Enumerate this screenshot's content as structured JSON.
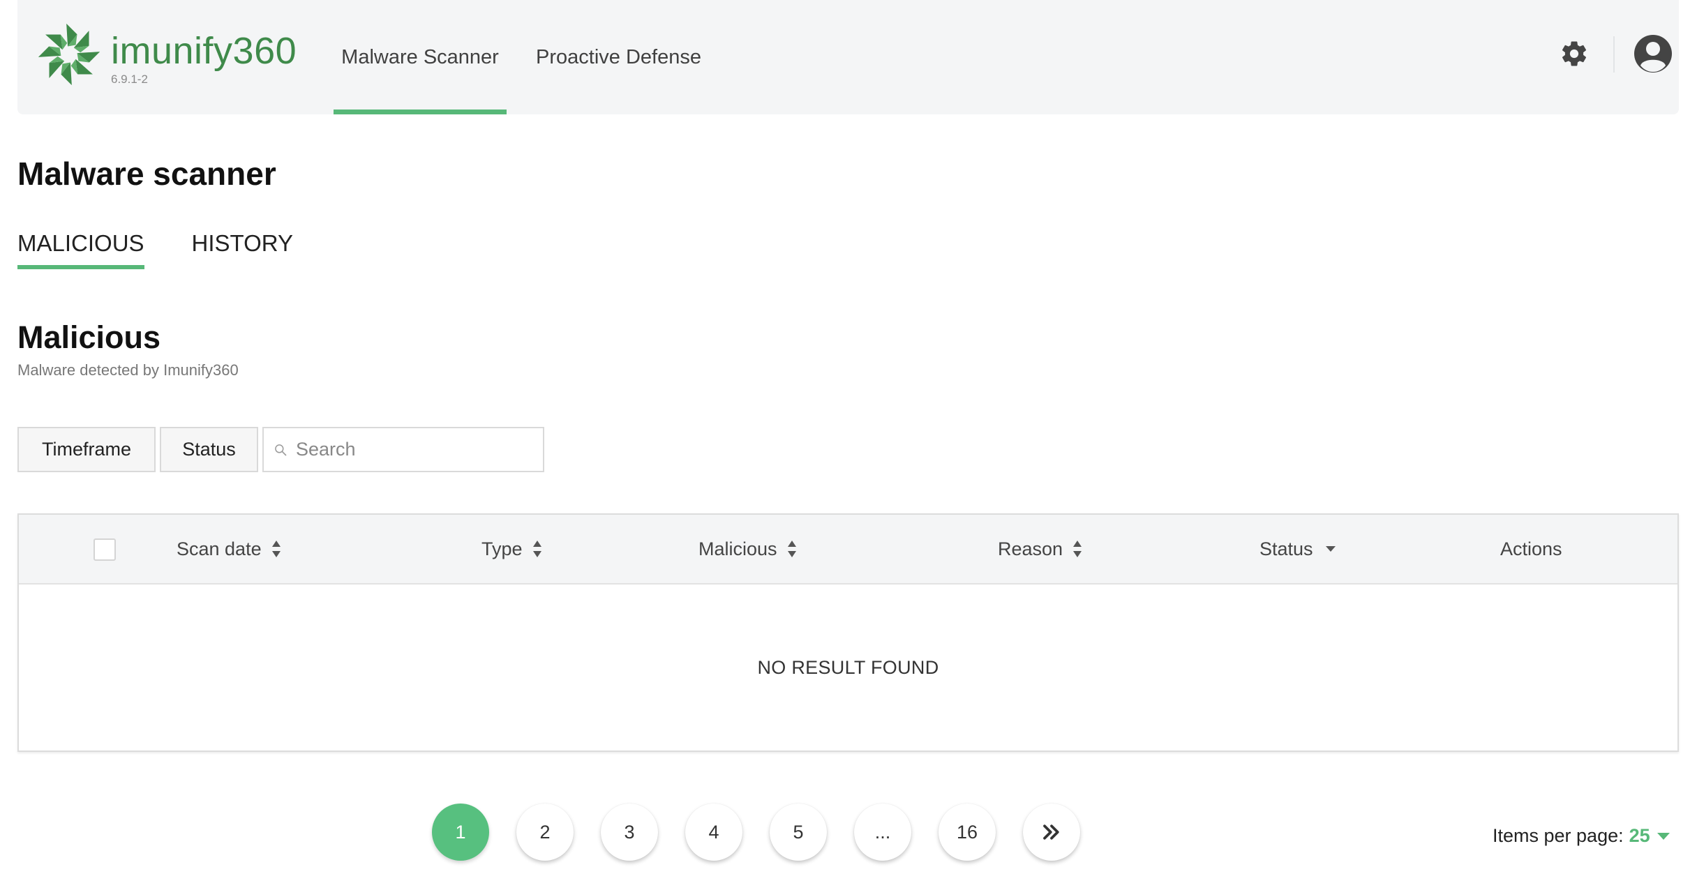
{
  "header": {
    "brand_prefix": "imunify",
    "brand_number": "360",
    "version": "6.9.1-2",
    "tabs": [
      {
        "label": "Malware Scanner",
        "active": true
      },
      {
        "label": "Proactive Defense",
        "active": false
      }
    ],
    "icons": {
      "settings": "gear-icon",
      "account": "user-avatar-icon"
    }
  },
  "page": {
    "title": "Malware scanner",
    "sub_tabs": [
      {
        "label": "MALICIOUS",
        "active": true
      },
      {
        "label": "HISTORY",
        "active": false
      }
    ]
  },
  "section": {
    "title": "Malicious",
    "subtitle": "Malware detected by Imunify360"
  },
  "filters": {
    "timeframe_label": "Timeframe",
    "status_label": "Status",
    "search_placeholder": "Search",
    "search_value": ""
  },
  "table": {
    "columns": [
      {
        "label": "Scan date",
        "sort": "both"
      },
      {
        "label": "Type",
        "sort": "both"
      },
      {
        "label": "Malicious",
        "sort": "both"
      },
      {
        "label": "Reason",
        "sort": "both"
      },
      {
        "label": "Status",
        "sort": "dropdown"
      },
      {
        "label": "Actions",
        "sort": "none"
      }
    ],
    "rows": [],
    "empty_text": "NO RESULT FOUND"
  },
  "pagination": {
    "pages": [
      "1",
      "2",
      "3",
      "4",
      "5",
      "...",
      "16"
    ],
    "current": "1"
  },
  "items_per_page": {
    "label": "Items per page:",
    "value": "25"
  },
  "colors": {
    "accent": "#57b878",
    "brand": "#3f8a4a",
    "active_page": "#57c07f",
    "header_bg": "#f4f5f6"
  }
}
